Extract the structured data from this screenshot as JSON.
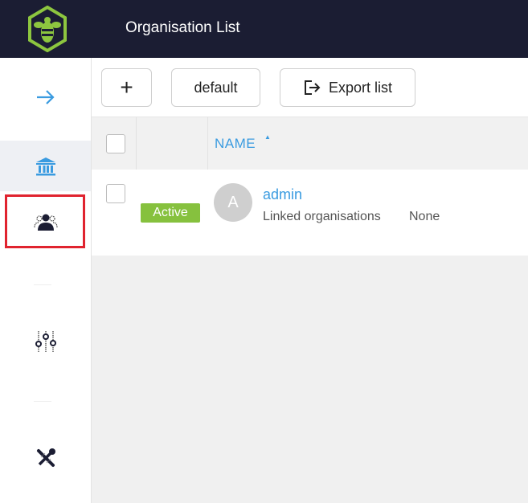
{
  "header": {
    "title": "Organisation List"
  },
  "sidebar": {
    "items": [
      {
        "name": "expand",
        "icon": "arrow-right-icon"
      },
      {
        "name": "organisations",
        "icon": "bank-icon",
        "active": true
      },
      {
        "name": "users",
        "icon": "users-icon",
        "highlighted": true
      },
      {
        "name": "settings",
        "icon": "sliders-icon"
      },
      {
        "name": "tools",
        "icon": "tools-icon"
      }
    ]
  },
  "toolbar": {
    "add_label": "+",
    "default_label": "default",
    "export_label": "Export list"
  },
  "table": {
    "columns": [
      {
        "label": "NAME",
        "sorted": "asc"
      }
    ],
    "rows": [
      {
        "status": "Active",
        "avatar_letter": "A",
        "name": "admin",
        "linked_label": "Linked organisations",
        "linked_value": "None"
      }
    ]
  },
  "colors": {
    "topbar": "#1b1d33",
    "accent": "#3a9be0",
    "active_badge": "#86c13e",
    "logo": "#8dc63f",
    "highlight": "#e0232f"
  }
}
